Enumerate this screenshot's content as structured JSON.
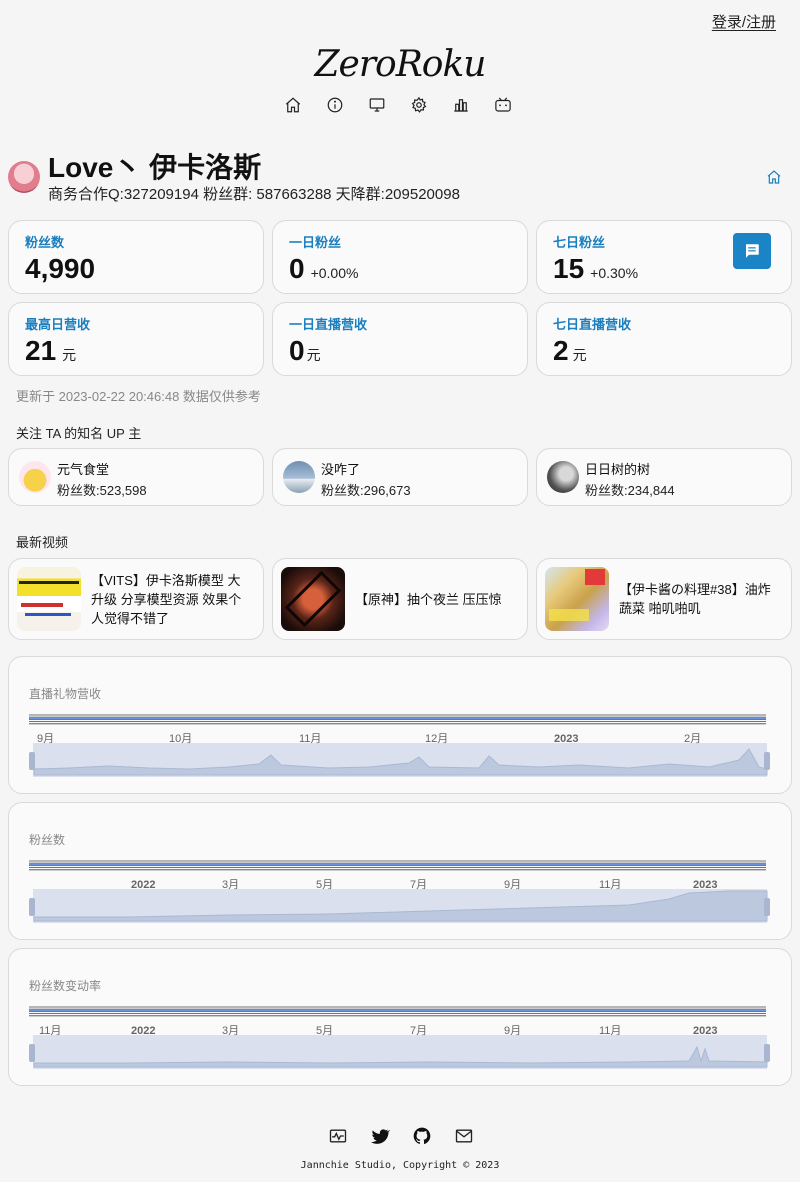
{
  "header": {
    "login_label": "登录/注册",
    "logo_text": "ZeroRoku",
    "nav_icons": [
      "home-icon",
      "info-icon",
      "monitor-icon",
      "settings-icon",
      "chart-icon",
      "bilibili-icon"
    ]
  },
  "profile": {
    "name": "Love丶 伊卡洛斯",
    "description": "商务合作Q:327209194 粉丝群: 587663288 天降群:209520098",
    "home_icon": "home-icon"
  },
  "stats": [
    {
      "label": "粉丝数",
      "value": "4,990",
      "extra": ""
    },
    {
      "label": "一日粉丝",
      "value": "0",
      "extra": "+0.00%"
    },
    {
      "label": "七日粉丝",
      "value": "15",
      "extra": "+0.30%"
    },
    {
      "label": "最高日营收",
      "value": "21",
      "extra": "元"
    },
    {
      "label": "一日直播营收",
      "value": "0",
      "extra": "元"
    },
    {
      "label": "七日直播营收",
      "value": "2",
      "extra": "元"
    }
  ],
  "updated_text": "更新于 2023-02-22 20:46:48 数据仅供参考",
  "followed_section": {
    "title": "关注 TA 的知名 UP 主",
    "items": [
      {
        "name": "元气食堂",
        "fans": "粉丝数:523,598"
      },
      {
        "name": "没咋了",
        "fans": "粉丝数:296,673"
      },
      {
        "name": "日日树的树",
        "fans": "粉丝数:234,844"
      }
    ]
  },
  "videos_section": {
    "title": "最新视频",
    "items": [
      {
        "title": "【VITS】伊卡洛斯模型 大升级 分享模型资源 效果个人觉得不错了"
      },
      {
        "title": "【原神】抽个夜兰 压压惊"
      },
      {
        "title": "【伊卡酱の料理#38】油炸蔬菜 啪叽啪叽"
      }
    ]
  },
  "charts": [
    {
      "title": "直播礼物营收",
      "x_labels": [
        {
          "text": "9月",
          "strong": false
        },
        {
          "text": "10月",
          "strong": false
        },
        {
          "text": "11月",
          "strong": false
        },
        {
          "text": "12月",
          "strong": false
        },
        {
          "text": "2023",
          "strong": true
        },
        {
          "text": "2月",
          "strong": false
        }
      ]
    },
    {
      "title": "粉丝数",
      "x_labels": [
        {
          "text": "2022",
          "strong": true
        },
        {
          "text": "3月",
          "strong": false
        },
        {
          "text": "5月",
          "strong": false
        },
        {
          "text": "7月",
          "strong": false
        },
        {
          "text": "9月",
          "strong": false
        },
        {
          "text": "11月",
          "strong": false
        },
        {
          "text": "2023",
          "strong": true
        }
      ]
    },
    {
      "title": "粉丝数变动率",
      "x_labels": [
        {
          "text": "11月",
          "strong": false
        },
        {
          "text": "2022",
          "strong": true
        },
        {
          "text": "3月",
          "strong": false
        },
        {
          "text": "5月",
          "strong": false
        },
        {
          "text": "7月",
          "strong": false
        },
        {
          "text": "9月",
          "strong": false
        },
        {
          "text": "11月",
          "strong": false
        },
        {
          "text": "2023",
          "strong": true
        }
      ]
    }
  ],
  "footer": {
    "icons": [
      "activity-icon",
      "twitter-icon",
      "github-icon",
      "mail-icon"
    ],
    "copyright": "Jannchie Studio, Copyright © 2023"
  },
  "colors": {
    "accent": "#1a7fbf",
    "button": "#1a84c7",
    "muted": "#888888",
    "slider_fill": "#d3dbea"
  }
}
